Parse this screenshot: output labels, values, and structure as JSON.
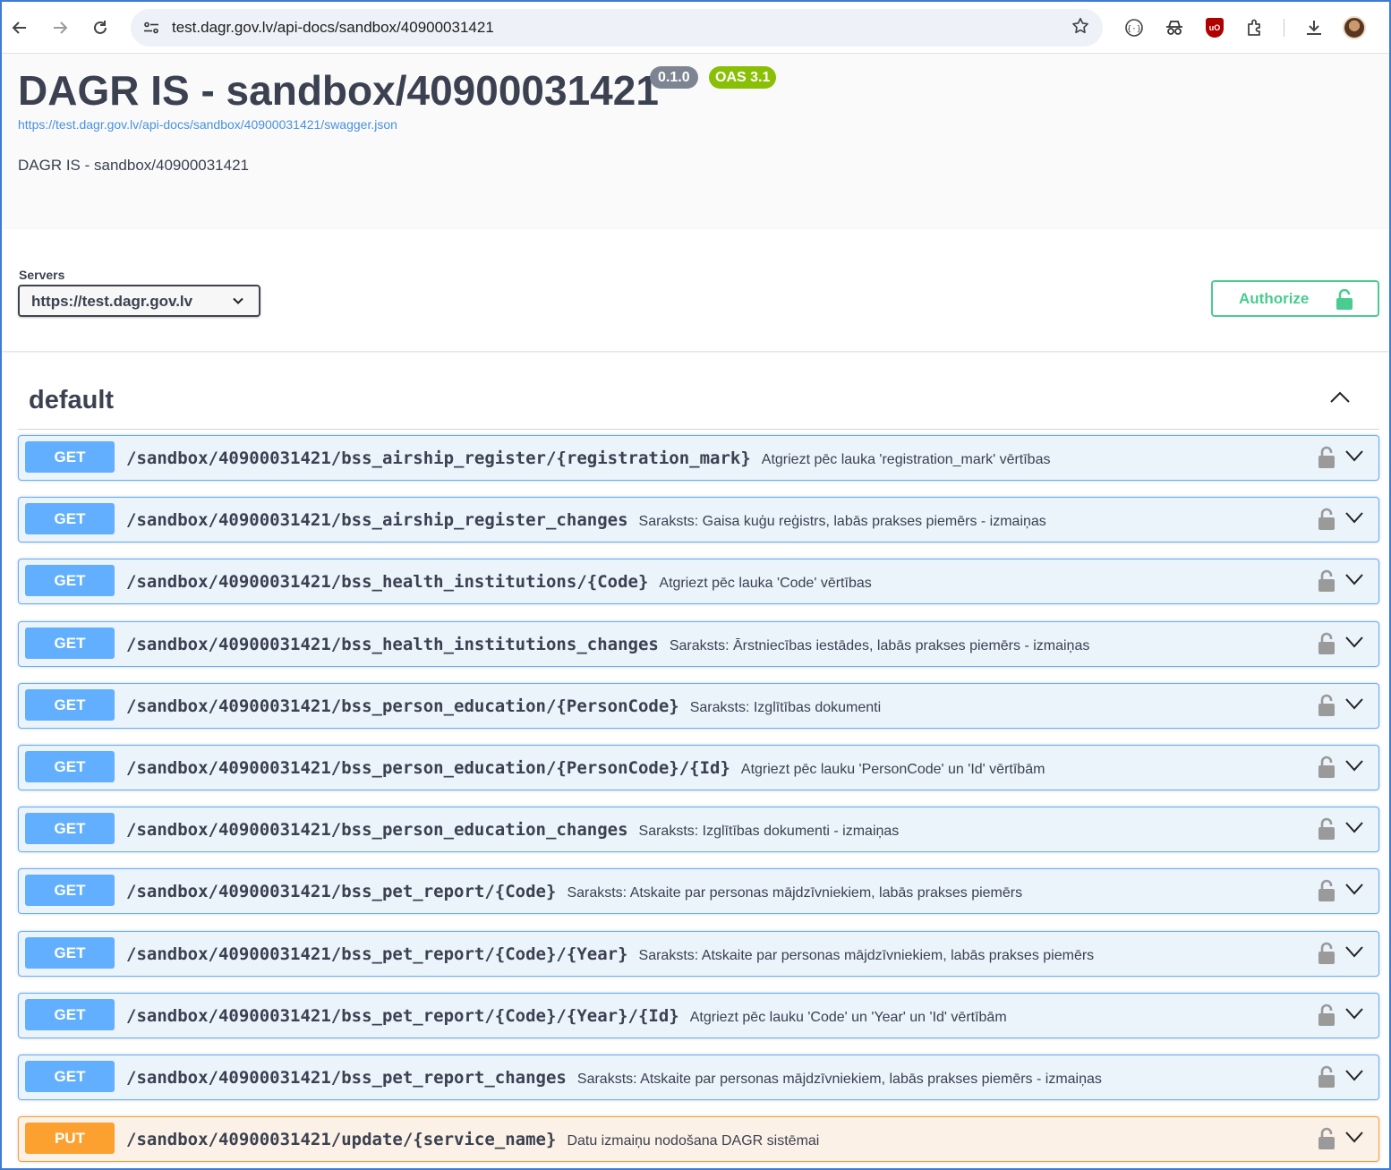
{
  "browser": {
    "url": "test.dagr.gov.lv/api-docs/sandbox/40900031421",
    "back_icon": "arrow-left-icon",
    "forward_icon": "arrow-right-icon",
    "reload_icon": "reload-icon"
  },
  "info": {
    "title": "DAGR IS - sandbox/40900031421",
    "version": "0.1.0",
    "oas": "OAS 3.1",
    "spec_url": "https://test.dagr.gov.lv/api-docs/sandbox/40900031421/swagger.json",
    "description": "DAGR IS - sandbox/40900031421"
  },
  "servers": {
    "label": "Servers",
    "selected": "https://test.dagr.gov.lv"
  },
  "authorize": {
    "label": "Authorize"
  },
  "tag": {
    "name": "default"
  },
  "operations": [
    {
      "method": "GET",
      "path": "/sandbox/40900031421/bss_airship_register/{registration_mark}",
      "summary": "Atgriezt pēc lauka 'registration_mark' vērtības"
    },
    {
      "method": "GET",
      "path": "/sandbox/40900031421/bss_airship_register_changes",
      "summary": "Saraksts: Gaisa kuģu reģistrs, labās prakses piemērs - izmaiņas"
    },
    {
      "method": "GET",
      "path": "/sandbox/40900031421/bss_health_institutions/{Code}",
      "summary": "Atgriezt pēc lauka 'Code' vērtības"
    },
    {
      "method": "GET",
      "path": "/sandbox/40900031421/bss_health_institutions_changes",
      "summary": "Saraksts: Ārstniecības iestādes, labās prakses piemērs - izmaiņas"
    },
    {
      "method": "GET",
      "path": "/sandbox/40900031421/bss_person_education/{PersonCode}",
      "summary": "Saraksts: Izglītības dokumenti"
    },
    {
      "method": "GET",
      "path": "/sandbox/40900031421/bss_person_education/{PersonCode}/{Id}",
      "summary": "Atgriezt pēc lauku 'PersonCode' un 'Id' vērtībām"
    },
    {
      "method": "GET",
      "path": "/sandbox/40900031421/bss_person_education_changes",
      "summary": "Saraksts: Izglītības dokumenti - izmaiņas"
    },
    {
      "method": "GET",
      "path": "/sandbox/40900031421/bss_pet_report/{Code}",
      "summary": "Saraksts: Atskaite par personas mājdzīvniekiem, labās prakses piemērs"
    },
    {
      "method": "GET",
      "path": "/sandbox/40900031421/bss_pet_report/{Code}/{Year}",
      "summary": "Saraksts: Atskaite par personas mājdzīvniekiem, labās prakses piemērs"
    },
    {
      "method": "GET",
      "path": "/sandbox/40900031421/bss_pet_report/{Code}/{Year}/{Id}",
      "summary": "Atgriezt pēc lauku 'Code' un 'Year' un 'Id' vērtībām"
    },
    {
      "method": "GET",
      "path": "/sandbox/40900031421/bss_pet_report_changes",
      "summary": "Saraksts: Atskaite par personas mājdzīvniekiem, labās prakses piemērs - izmaiņas"
    },
    {
      "method": "PUT",
      "path": "/sandbox/40900031421/update/{service_name}",
      "summary": "Datu izmaiņu nodošana DAGR sistēmai"
    }
  ],
  "colors": {
    "get": "#61affe",
    "put": "#fca130",
    "authorize": "#49cc90",
    "oas_badge": "#89bf04",
    "version_badge": "#7d8492"
  }
}
